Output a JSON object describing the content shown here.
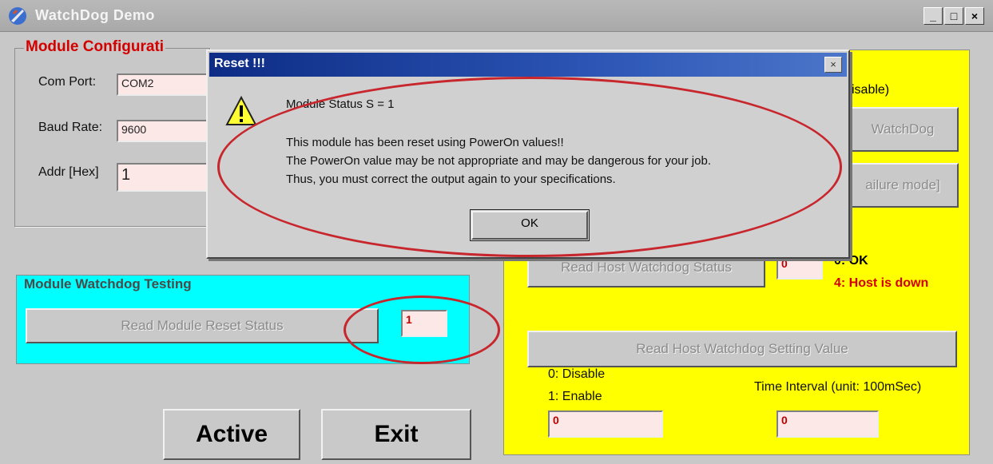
{
  "window": {
    "title": "WatchDog Demo",
    "minimize": "_",
    "maximize": "□",
    "close": "×"
  },
  "module_config": {
    "title": "Module Configurati",
    "com_port_label": "Com Port:",
    "com_port_value": "COM2",
    "baud_rate_label": "Baud Rate:",
    "baud_rate_value": "9600",
    "addr_label": "Addr [Hex]",
    "addr_value": "1"
  },
  "host_panel": {
    "partial_label_1": "isable)",
    "watchdog_button_partial": "WatchDog",
    "failure_mode_button_partial": "ailure mode]",
    "read_host_status_button": "Read Host Watchdog Status",
    "host_status_value": "0",
    "status_legend_ok": "0: OK",
    "status_legend_down": "4: Host is down",
    "read_host_setting_button": "Read Host Watchdog Setting Value",
    "disable_legend": "0: Disable",
    "enable_legend": "1: Enable",
    "time_interval_label": "Time Interval (unit: 100mSec)",
    "setting_value": "0",
    "time_interval_value": "0"
  },
  "module_watchdog": {
    "title": "Module Watchdog Testing",
    "read_reset_button": "Read Module Reset Status",
    "reset_status_value": "1"
  },
  "buttons": {
    "active": "Active",
    "exit": "Exit"
  },
  "dialog": {
    "title": "Reset !!!",
    "close": "×",
    "status_line": "Module Status S = 1",
    "line1": "This module has been reset using PowerOn values!!",
    "line2": "The PowerOn value may be not appropriate and may be dangerous for your job.",
    "line3": "Thus, you must correct the output again to your specifications.",
    "ok": "OK"
  },
  "colors": {
    "yellow_panel": "#ffff00",
    "cyan_panel": "#00ffff",
    "title_red": "#d40000",
    "annotation_red": "#c8262d"
  }
}
